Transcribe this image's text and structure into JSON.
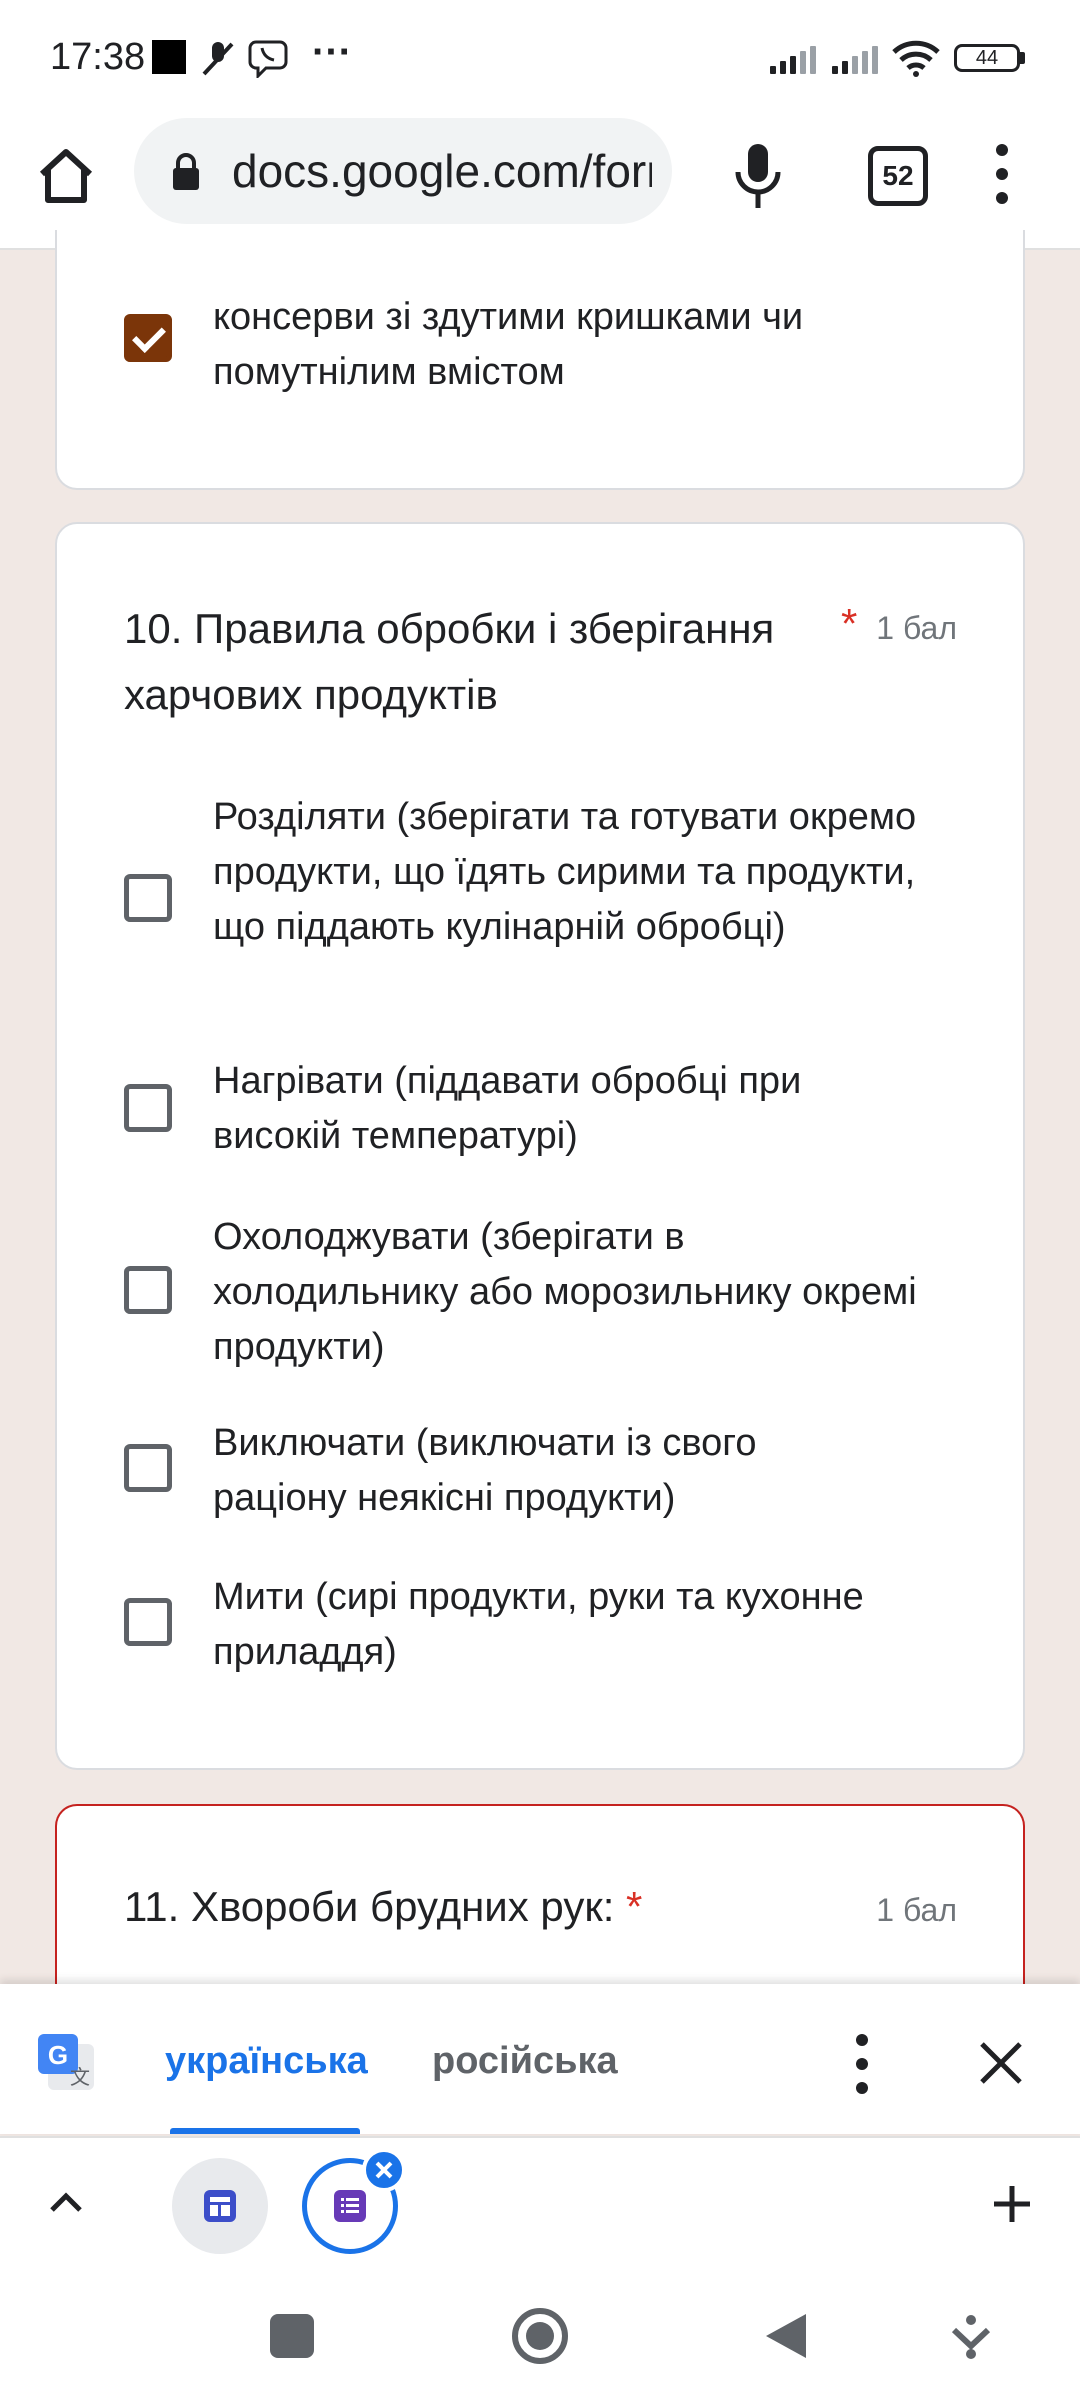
{
  "status_bar": {
    "time": "17:38",
    "battery": "44",
    "icons": [
      "black-square-icon",
      "mic-muted-icon",
      "viber-icon",
      "more-icon",
      "signal-icon",
      "signal-icon",
      "wifi-icon",
      "battery-icon"
    ],
    "more": "···"
  },
  "browser": {
    "url": "docs.google.com/forms",
    "tab_count": "52"
  },
  "form": {
    "prev_option": {
      "text": "консерви зі здутими кришками чи помутнілим вмістом",
      "checked": true
    },
    "question10": {
      "title": "10. Правила обробки і зберігання харчових продуктів",
      "required_mark": "*",
      "points": "1 бал",
      "options": [
        "Розділяти (зберігати та готувати окремо продукти, що їдять сирими та продукти, що піддають кулінарній обробці)",
        "Нагрівати (піддавати обробці при високій температурі)",
        "Охолоджувати (зберігати в холодильнику або морозильнику окремі продукти)",
        "Виключати (виключати із свого раціону неякісні продукти)",
        "Мити (сирі продукти, руки та кухонне приладдя)"
      ]
    },
    "question11": {
      "title": "11. Хвороби брудних рук:",
      "required_mark": "*",
      "points": "1 бал"
    }
  },
  "translate_bar": {
    "lang_active": "українська",
    "lang_other": "російська"
  },
  "colors": {
    "accent": "#1a73e8",
    "checkbox_checked": "#7b3509",
    "required": "#d93025",
    "page_bg": "#f1e8e4"
  }
}
